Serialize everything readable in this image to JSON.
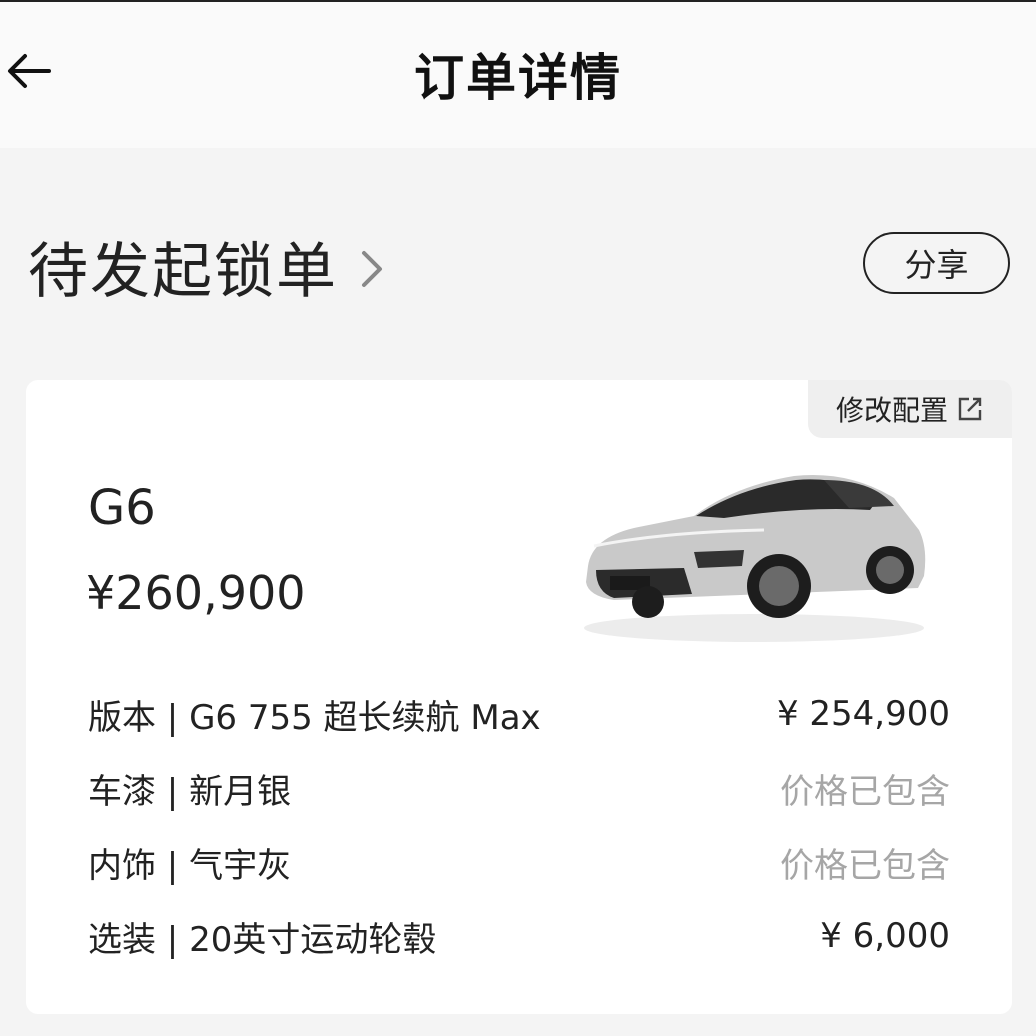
{
  "header": {
    "title": "订单详情"
  },
  "status": {
    "text": "待发起锁单",
    "share_label": "分享"
  },
  "card": {
    "modify_label": "修改配置",
    "model_name": "G6",
    "model_price": "¥260,900",
    "specs": [
      {
        "label": "版本 | G6 755 超长续航 Max",
        "value": "¥ 254,900"
      },
      {
        "label": "车漆 | 新月银",
        "value": "价格已包含"
      },
      {
        "label": "内饰 | 气宇灰",
        "value": "价格已包含"
      },
      {
        "label": "选装 | 20英寸运动轮毂",
        "value": "¥ 6,000"
      }
    ]
  }
}
